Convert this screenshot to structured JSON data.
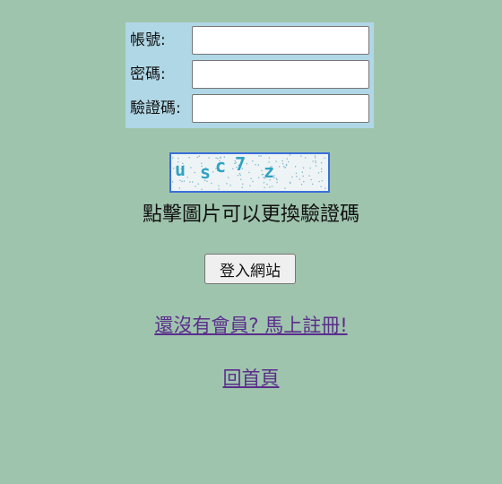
{
  "form": {
    "account_label": "帳號:",
    "password_label": "密碼:",
    "captcha_label": "驗證碼:",
    "account_value": "",
    "password_value": "",
    "captcha_value": ""
  },
  "captcha": {
    "characters": [
      "u",
      "s",
      "c",
      "7",
      "z"
    ],
    "text_color": "#2fa3c4",
    "border_color": "#3a6fd8",
    "hint": "點擊圖片可以更換驗證碼"
  },
  "actions": {
    "login_label": "登入網站",
    "register_link": "還沒有會員? 馬上註冊!",
    "home_link": "回首頁"
  },
  "colors": {
    "page_background": "#9fc4ad",
    "form_background": "#b0d7e6",
    "link": "#5a2d8c"
  }
}
